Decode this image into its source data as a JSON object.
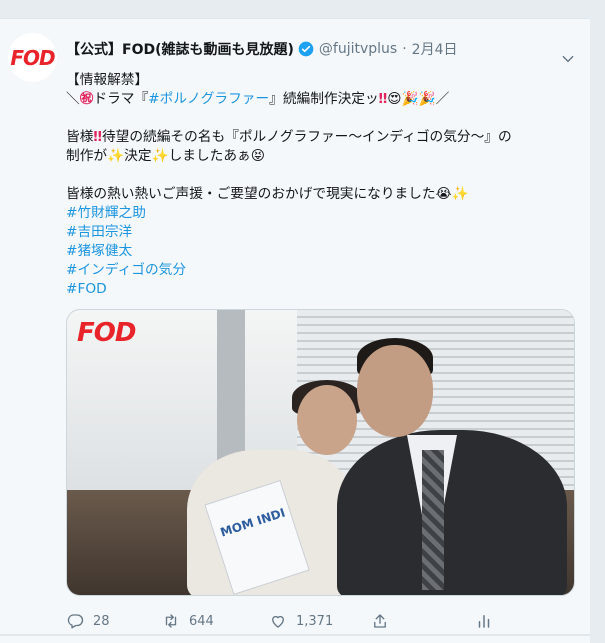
{
  "tweet": {
    "author_name": "【公式】FOD(雑誌も動画も見放題)",
    "handle": "@fujitvplus",
    "separator": "·",
    "date": "2月4日",
    "avatar_logo": "FOD",
    "lines": {
      "l1": "【情報解禁】",
      "l2a": "＼",
      "l2_emoji": "㊗",
      "l2b": "ドラマ『",
      "l2_tag": "#ポルノグラファー",
      "l2c": "』続編制作決定ッ",
      "l2_bang": "‼",
      "l2_end": "😍🎉🎉／",
      "l3a": "皆様",
      "l3_bang": "‼",
      "l3b": "待望の続編その名も『ポルノグラファー〜インディゴの気分〜』の",
      "l4a": "制作が",
      "l4_sparkle1": "✨",
      "l4b": "決定",
      "l4_sparkle2": "✨",
      "l4c": "しましたあぁ😝",
      "l5a": "皆様の熱い熱いご声援・ご要望のおかげで現実になりました😭",
      "l5_sparkle": "✨"
    },
    "hashtags": [
      "#竹財輝之助",
      "#吉田宗洋",
      "#猪塚健太",
      "#インディゴの気分",
      "#FOD"
    ],
    "media": {
      "logo": "FOD",
      "book_text": "MOM INDI"
    },
    "actions": {
      "reply_count": "28",
      "retweet_count": "644",
      "like_count": "1,371"
    }
  },
  "colors": {
    "accent": "#1b95e0",
    "brand_red": "#e8232a",
    "muted": "#657786",
    "verified": "#1da1f2"
  },
  "icons": [
    "verified-badge-icon",
    "caret-down-icon",
    "reply-icon",
    "retweet-icon",
    "like-icon",
    "share-icon",
    "analytics-icon"
  ]
}
